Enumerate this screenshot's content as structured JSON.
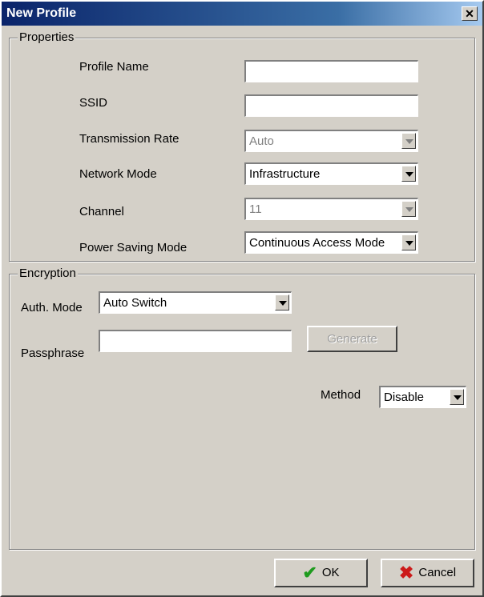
{
  "window": {
    "title": "New Profile",
    "close_glyph": "✕"
  },
  "properties": {
    "group_label": "Properties",
    "profile_name_label": "Profile Name",
    "profile_name_value": "",
    "ssid_label": "SSID",
    "ssid_value": "",
    "tx_rate_label": "Transmission Rate",
    "tx_rate_value": "Auto",
    "network_mode_label": "Network Mode",
    "network_mode_value": "Infrastructure",
    "channel_label": "Channel",
    "channel_value": "11",
    "power_saving_label": "Power Saving Mode",
    "power_saving_value": "Continuous Access Mode"
  },
  "encryption": {
    "group_label": "Encryption",
    "auth_mode_label": "Auth. Mode",
    "auth_mode_value": "Auto Switch",
    "passphrase_label": "Passphrase",
    "passphrase_value": "",
    "generate_label": "Generate",
    "method_label": "Method",
    "method_value": "Disable"
  },
  "footer": {
    "ok_label": "OK",
    "ok_icon": "checkmark-icon",
    "cancel_label": "Cancel",
    "cancel_icon": "x-icon"
  }
}
